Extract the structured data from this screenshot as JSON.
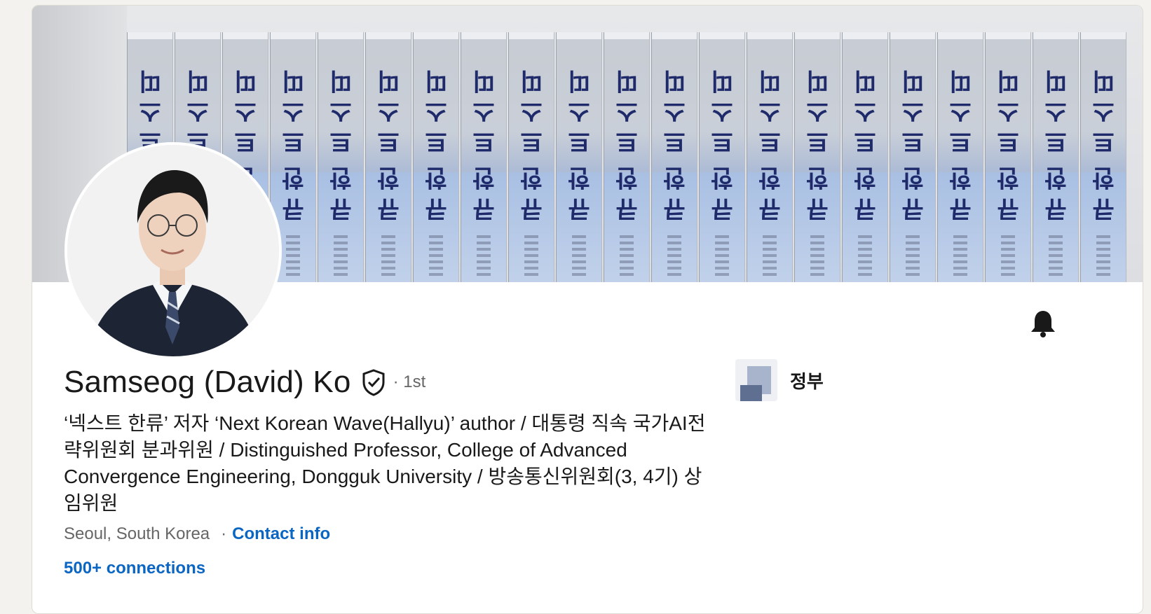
{
  "profile": {
    "name": "Samseog (David) Ko",
    "degree": "· 1st",
    "headline": "‘넥스트 한류’ 저자 ‘Next Korean Wave(Hallyu)’ author / 대통령 직속 국가AI전략위원회 분과위원 / Distinguished Professor, College of Advanced Convergence Engineering, Dongguk University / 방송통신위원회(3, 4기) 상임위원",
    "location": "Seoul, South Korea",
    "location_separator": "·",
    "contact_info_label": "Contact info",
    "connections_label": "500+ connections"
  },
  "organization": {
    "name": "정부"
  },
  "banner": {
    "spine_glyphs": [
      "띠",
      "스",
      "트",
      "한",
      "큐"
    ]
  },
  "icons": {
    "verified": "shield-check-icon",
    "bell": "bell-icon"
  },
  "colors": {
    "link": "#0a66c2",
    "page_background": "#f4f2ee",
    "card_background": "#ffffff",
    "banner_spine_text": "#1f2a6b"
  }
}
